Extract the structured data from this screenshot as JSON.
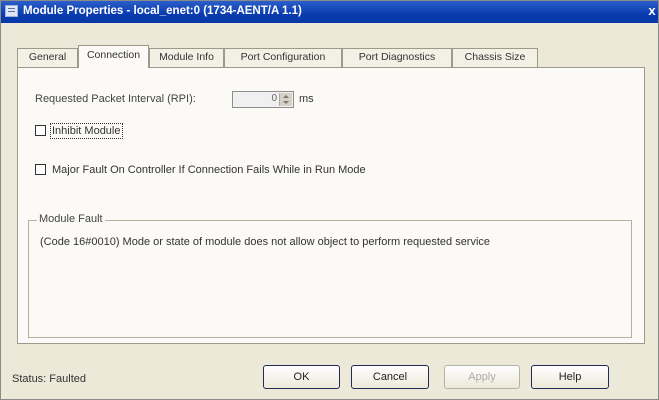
{
  "window": {
    "title": "Module Properties - local_enet:0 (1734-AENT/A 1.1)",
    "close_glyph": "x"
  },
  "tabs": [
    {
      "label": "General",
      "active": false
    },
    {
      "label": "Connection",
      "active": true
    },
    {
      "label": "Module Info",
      "active": false
    },
    {
      "label": "Port Configuration",
      "active": false
    },
    {
      "label": "Port Diagnostics",
      "active": false
    },
    {
      "label": "Chassis Size",
      "active": false
    }
  ],
  "connection": {
    "rpi_label": "Requested Packet Interval (RPI):",
    "rpi_value": "0",
    "rpi_units": "ms",
    "inhibit_label": "Inhibit Module",
    "inhibit_checked": false,
    "major_fault_label": "Major Fault On Controller If Connection Fails While in Run Mode",
    "major_fault_checked": false
  },
  "module_fault": {
    "title": "Module Fault",
    "message": "(Code 16#0010) Mode or state of module does not allow object to perform requested service"
  },
  "status": {
    "text": "Status:  Faulted"
  },
  "buttons": {
    "ok": "OK",
    "cancel": "Cancel",
    "apply": "Apply",
    "help": "Help"
  },
  "colors": {
    "titlebar": "#0a3cb0",
    "dialog_bg": "#ece9d8",
    "panel_bg": "#fbfaf6"
  },
  "icons": [
    "window-icon",
    "close-icon",
    "spinner-icon"
  ]
}
